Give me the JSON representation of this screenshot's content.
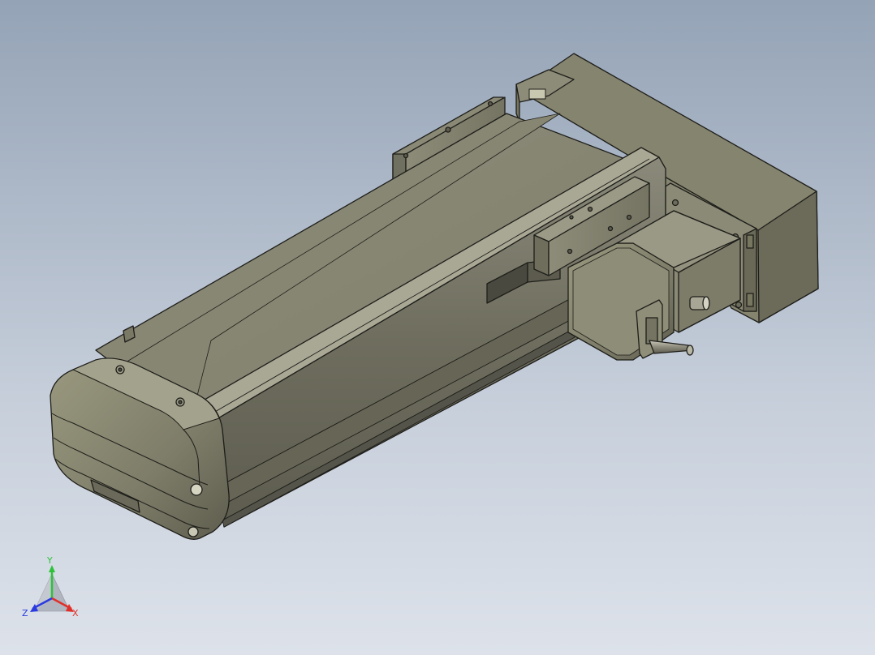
{
  "viewport": {
    "background_top": "#94a3b6",
    "background_bottom": "#dde2ea"
  },
  "model": {
    "body_color": "#8c8b78",
    "edge_color": "#1e1e1a",
    "motor_color": "#888772"
  },
  "triad": {
    "x_label": "X",
    "y_label": "Y",
    "z_label": "Z",
    "x_color": "#e0302a",
    "y_color": "#2ec23a",
    "z_color": "#2a3ae0"
  }
}
